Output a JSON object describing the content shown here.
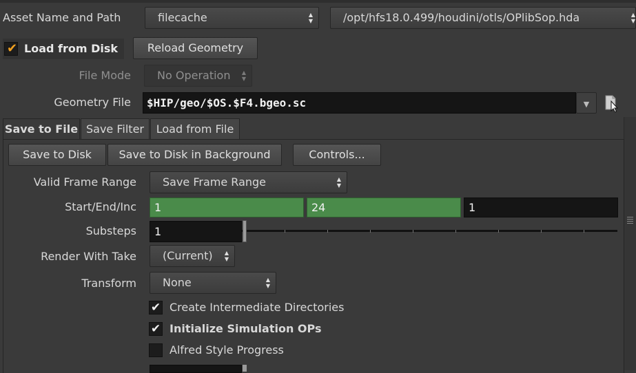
{
  "asset": {
    "label": "Asset Name and Path",
    "name": "filecache",
    "path": "/opt/hfs18.0.499/houdini/otls/OPlibSop.hda"
  },
  "load": {
    "load_from_disk_label": "Load from Disk",
    "load_from_disk_checked": true,
    "reload_button": "Reload Geometry",
    "file_mode_label": "File Mode",
    "file_mode_value": "No Operation",
    "geometry_file_label": "Geometry File",
    "geometry_file_value": "$HIP/geo/$OS.$F4.bgeo.sc"
  },
  "tabs": [
    {
      "label": "Save to File",
      "active": true
    },
    {
      "label": "Save Filter",
      "active": false
    },
    {
      "label": "Load from File",
      "active": false
    }
  ],
  "actions": {
    "save_to_disk": "Save to Disk",
    "save_to_disk_background": "Save to Disk in Background",
    "controls": "Controls..."
  },
  "params": {
    "valid_frame_range_label": "Valid Frame Range",
    "valid_frame_range_value": "Save Frame Range",
    "start_end_inc_label": "Start/End/Inc",
    "start": "1",
    "end": "24",
    "inc": "1",
    "substeps_label": "Substeps",
    "substeps_value": "1",
    "render_with_take_label": "Render With Take",
    "render_with_take_value": "(Current)",
    "transform_label": "Transform",
    "transform_value": "None"
  },
  "toggles": [
    {
      "label": "Create Intermediate Directories",
      "checked": true,
      "bold": false
    },
    {
      "label": "Initialize Simulation OPs",
      "checked": true,
      "bold": true
    },
    {
      "label": "Alfred Style Progress",
      "checked": false,
      "bold": false
    }
  ],
  "icons": {
    "combo_arrows": "up-down-arrows-icon",
    "file_chooser": "file-chooser-icon",
    "dropdown": "chevron-down-icon",
    "checkmark": "checkmark-icon"
  },
  "colors": {
    "background": "#3a3a3a",
    "field_dark": "#151515",
    "field_green": "#4a8b4a",
    "load_checkbox": "#f0a020"
  }
}
